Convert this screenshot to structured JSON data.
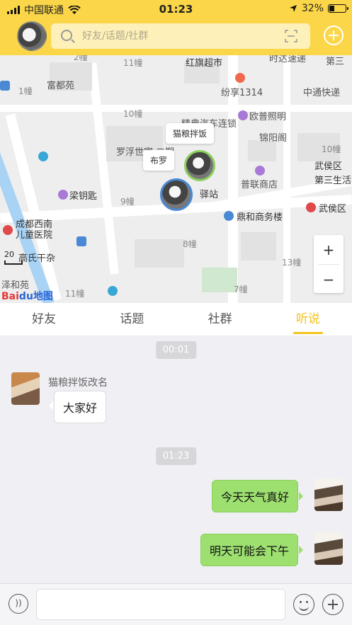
{
  "status_bar": {
    "carrier": "中国联通",
    "time": "01:23",
    "battery": "32%",
    "battery_level": 0.32
  },
  "header": {
    "search_placeholder": "好友/话题/社群"
  },
  "map": {
    "labels": {
      "hongqi": "红旗超市",
      "fudu": "富都苑",
      "fenxiang": "纷享1314",
      "zhongtong": "中通快递",
      "oupu": "欧普照明",
      "jinyang": "锦阳阁",
      "luofu": "罗浮世家·二期",
      "jingdian": "精典汽车连锁",
      "wuhou": "武侯区",
      "third": "第三生活",
      "puliang": "普联商店",
      "dinghe": "鼎和商务楼",
      "wuhou_qu": "武侯区",
      "liangyaoshi": "梁钥匙",
      "hospital": "成都西南儿童医院",
      "gaoshi": "高氏干杂",
      "zhan": "驿站",
      "shida": "时达速递",
      "disan": "第三",
      "xiehe": "泽和苑"
    },
    "house_numbers": [
      "11幢",
      "2幢",
      "1幢",
      "10幢",
      "9幢",
      "8幢",
      "10幢",
      "13幢",
      "11幢",
      "7幢"
    ],
    "pins": {
      "pin1_label": "猫粮拌饭",
      "pin2_label": "布罗"
    },
    "scale": "20",
    "logo_bai": "Bai",
    "logo_du": "du地图",
    "zoom_in": "+",
    "zoom_out": "−"
  },
  "tabs": [
    {
      "label": "好友"
    },
    {
      "label": "话题"
    },
    {
      "label": "社群"
    },
    {
      "label": "听说"
    }
  ],
  "chat": {
    "time1": "00:01",
    "sender": "猫粮拌饭改名",
    "msg1": "大家好",
    "time2": "01:23",
    "msg2": "今天天气真好",
    "msg3": "明天可能会下午"
  }
}
